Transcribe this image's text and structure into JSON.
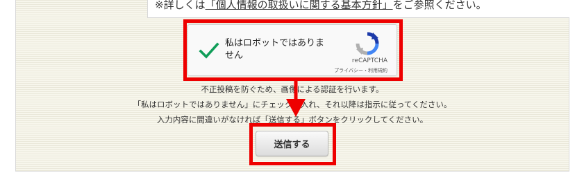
{
  "privacy_note": {
    "prefix": "※詳しくは",
    "link_text": "「個人情報の取扱いに関する基本方針」",
    "suffix": "をご参照ください。"
  },
  "recaptcha": {
    "label": "私はロボットではありません",
    "brand": "reCAPTCHA",
    "links": "プライバシー・利用規約",
    "checked": true,
    "check_color": "#0f9d58"
  },
  "instructions": [
    "不正投稿を防ぐため、画像による認証を行います。",
    "「私はロボットではありません」にチェックを入れ、それ以降は指示に従ってください。",
    "入力内容に間違いがなければ「送信する」ボタンをクリックしてください。"
  ],
  "submit_button": {
    "label": "送信する"
  },
  "annotation": {
    "color": "#ee0000"
  }
}
